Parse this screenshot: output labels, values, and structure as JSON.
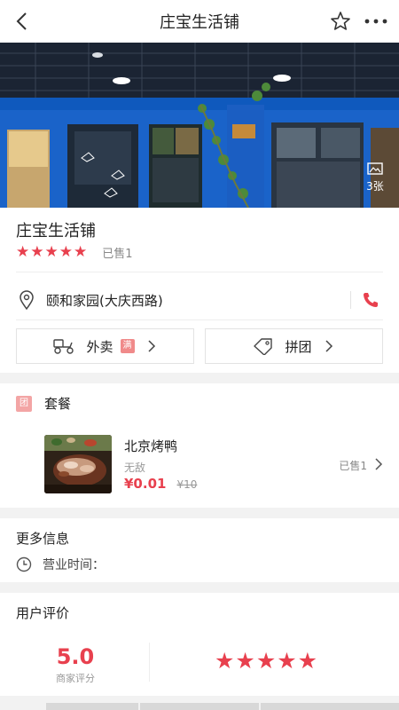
{
  "header": {
    "title": "庄宝生活铺"
  },
  "hero": {
    "photo_count": "3张"
  },
  "shop": {
    "name": "庄宝生活铺",
    "stars": "★★★★★",
    "sold": "已售1",
    "address": "颐和家园(大庆西路)"
  },
  "services": [
    {
      "label": "外卖",
      "badge": "满"
    },
    {
      "label": "拼团"
    }
  ],
  "package": {
    "badge": "团",
    "title": "套餐",
    "item": {
      "name": "北京烤鸭",
      "desc": "无敌",
      "price": "¥0.01",
      "original_price": "¥10",
      "sold": "已售1"
    }
  },
  "more_info": {
    "title": "更多信息",
    "hours_label": "营业时间："
  },
  "reviews": {
    "title": "用户评价",
    "score": "5.0",
    "score_label": "商家评分",
    "stars": "★★★★★"
  },
  "colors": {
    "accent": "#e8404e",
    "storefront_blue": "#1a63c9"
  },
  "icons": {
    "back": "chevron-left-icon",
    "favorite": "star-outline-icon",
    "more": "more-dots-icon",
    "photos": "image-icon",
    "location": "location-pin-icon",
    "phone": "phone-icon",
    "delivery": "scooter-icon",
    "group_buy": "price-tag-icon",
    "clock": "clock-icon"
  }
}
